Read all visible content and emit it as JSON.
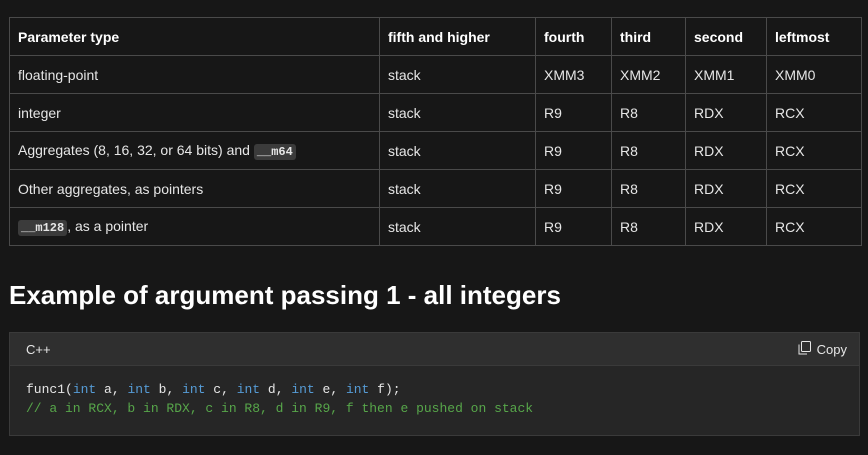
{
  "table": {
    "headers": [
      "Parameter type",
      "fifth and higher",
      "fourth",
      "third",
      "second",
      "leftmost"
    ],
    "rows": [
      {
        "type": "floating-point",
        "fifth": "stack",
        "fourth": "XMM3",
        "third": "XMM2",
        "second": "XMM1",
        "leftmost": "XMM0"
      },
      {
        "type": "integer",
        "fifth": "stack",
        "fourth": "R9",
        "third": "R8",
        "second": "RDX",
        "leftmost": "RCX"
      },
      {
        "type_prefix": "Aggregates (8, 16, 32, or 64 bits) and ",
        "type_code": "__m64",
        "fifth": "stack",
        "fourth": "R9",
        "third": "R8",
        "second": "RDX",
        "leftmost": "RCX"
      },
      {
        "type": "Other aggregates, as pointers",
        "fifth": "stack",
        "fourth": "R9",
        "third": "R8",
        "second": "RDX",
        "leftmost": "RCX"
      },
      {
        "type_code": "__m128",
        "type_suffix": ", as a pointer",
        "fifth": "stack",
        "fourth": "R9",
        "third": "R8",
        "second": "RDX",
        "leftmost": "RCX"
      }
    ]
  },
  "section_title": "Example of argument passing 1 - all integers",
  "code": {
    "language": "C++",
    "copy_label": "Copy",
    "line1": {
      "fn": "func1(",
      "kw": "int",
      "a": " a, ",
      "b": " b, ",
      "c": " c, ",
      "d": " d, ",
      "e": " e, ",
      "f": " f);"
    },
    "line2": "// a in RCX, b in RDX, c in R8, d in R9, f then e pushed on stack"
  },
  "colors": {
    "keyword": "#569cd6",
    "comment": "#57a64a",
    "background": "#171717"
  },
  "icons": [
    "copy-icon"
  ]
}
